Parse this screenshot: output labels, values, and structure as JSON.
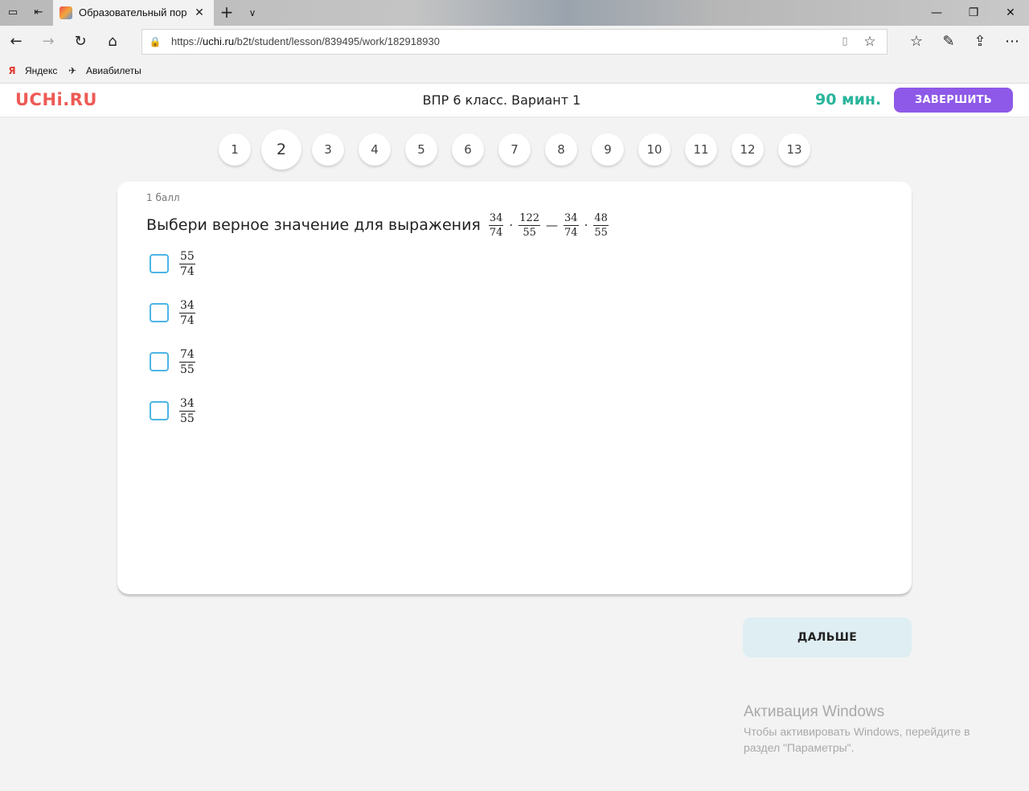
{
  "browser": {
    "tab_title": "Образовательный пор",
    "url_prefix": "https://",
    "url_host": "uchi.ru",
    "url_path": "/b2t/student/lesson/839495/work/182918930",
    "bookmarks": [
      {
        "label": "Яндекс",
        "icon": "Я"
      },
      {
        "label": "Авиабилеты",
        "icon": "✈"
      }
    ],
    "icons": {
      "tab_actions": "▭",
      "tab_aside": "⇤",
      "close": "✕",
      "new_tab": "+",
      "tab_menu": "∨",
      "minimize": "—",
      "restore": "❐",
      "win_close": "✕",
      "back": "←",
      "forward": "→",
      "refresh": "↻",
      "home": "⌂",
      "lock": "🔒",
      "reading": "▯",
      "star": "☆",
      "favorites": "☆",
      "pen": "✎",
      "share": "⇪",
      "more": "⋯"
    }
  },
  "header": {
    "logo": "UCHi.RU",
    "title": "ВПР 6 класс. Вариант 1",
    "timer": "90 мин.",
    "finish_label": "ЗАВЕРШИТЬ",
    "accent": "#8e59e8",
    "timer_color": "#29b59b"
  },
  "question_nav": {
    "items": [
      "1",
      "2",
      "3",
      "4",
      "5",
      "6",
      "7",
      "8",
      "9",
      "10",
      "11",
      "12",
      "13"
    ],
    "active": "2"
  },
  "question": {
    "points": "1 балл",
    "text": "Выбери верное значение для выражения",
    "expression": {
      "f1": {
        "num": "34",
        "den": "74"
      },
      "op1": "·",
      "f2": {
        "num": "122",
        "den": "55"
      },
      "op2": "—",
      "f3": {
        "num": "34",
        "den": "74"
      },
      "op3": "·",
      "f4": {
        "num": "48",
        "den": "55"
      }
    },
    "options": [
      {
        "num": "55",
        "den": "74"
      },
      {
        "num": "34",
        "den": "74"
      },
      {
        "num": "74",
        "den": "55"
      },
      {
        "num": "34",
        "den": "55"
      }
    ]
  },
  "next_label": "ДАЛЬШЕ",
  "watermark": {
    "title": "Активация Windows",
    "line1": "Чтобы активировать Windows, перейдите в",
    "line2": "раздел \"Параметры\"."
  }
}
